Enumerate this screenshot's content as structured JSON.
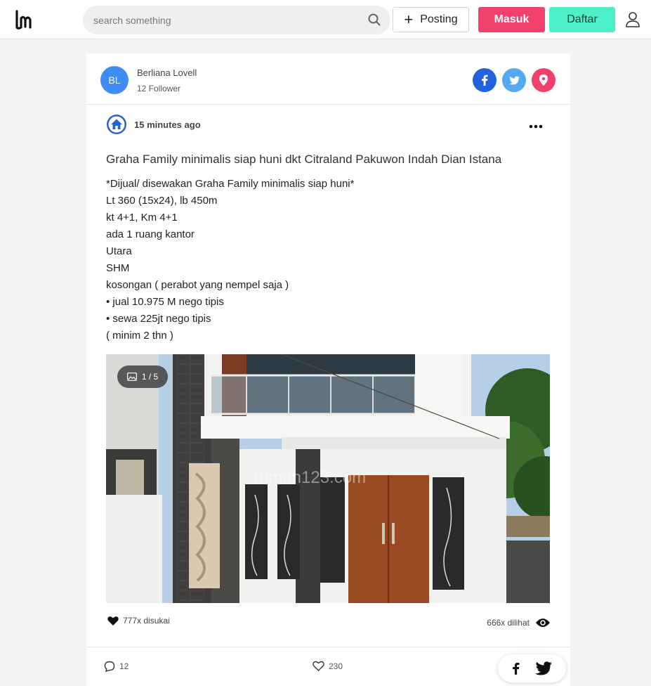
{
  "navbar": {
    "logo_icon": "lm-logo",
    "search_placeholder": "search something",
    "posting_label": "Posting",
    "masuk_label": "Masuk",
    "daftar_label": "Daftar",
    "colors": {
      "masuk": "#f1406b",
      "daftar": "#4df0c8"
    }
  },
  "author": {
    "initials": "BL",
    "name": "Berliana Lovell",
    "followers": "12 Follower"
  },
  "share_icons": [
    "facebook-icon",
    "twitter-icon",
    "location-pin-icon"
  ],
  "post": {
    "time": "15 minutes ago",
    "title": "Graha Family minimalis siap huni dkt Citraland Pakuwon Indah Dian Istana",
    "description_lines": [
      "*Dijual/ disewakan Graha Family minimalis siap huni*",
      "Lt 360 (15x24), lb 450m",
      "kt 4+1, Km 4+1",
      "ada 1 ruang kantor",
      "Utara",
      "SHM",
      "kosongan ( perabot yang nempel saja )",
      "• jual 10.975 M nego tipis",
      "• sewa 225jt nego tipis",
      "( minim 2 thn )"
    ],
    "photo_counter": "1 / 5",
    "watermark": "rumah123.com",
    "likes": "777x disukai",
    "views": "666x dilihat",
    "comments_count": "12",
    "reactions_count": "230"
  }
}
